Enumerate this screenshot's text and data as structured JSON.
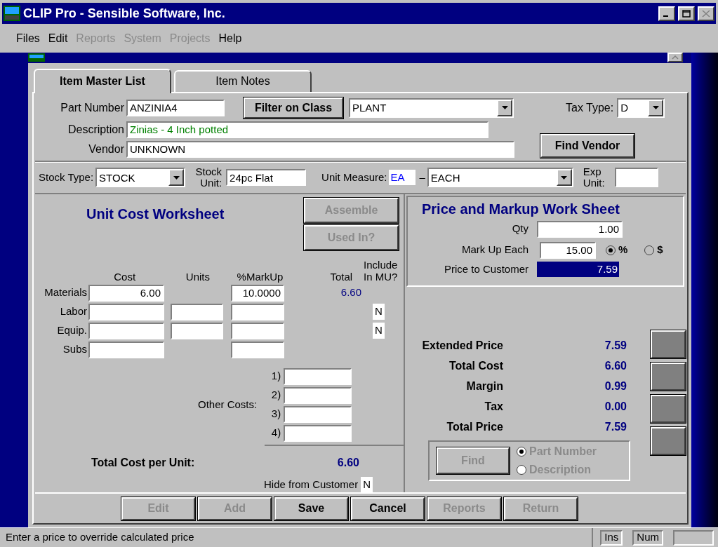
{
  "window": {
    "title": "CLIP Pro - Sensible Software, Inc."
  },
  "menu": [
    {
      "label": "Files",
      "disabled": false
    },
    {
      "label": "Edit",
      "disabled": false
    },
    {
      "label": "Reports",
      "disabled": true
    },
    {
      "label": "System",
      "disabled": true
    },
    {
      "label": "Projects",
      "disabled": true
    },
    {
      "label": "Help",
      "disabled": false
    }
  ],
  "tabs": [
    {
      "label": "Item Master List",
      "selected": true
    },
    {
      "label": "Item Notes",
      "selected": false
    }
  ],
  "part_number": {
    "label": "Part Number",
    "value": "ANZINIA4"
  },
  "filter_button": {
    "label": "Filter on Class"
  },
  "class_select": {
    "value": "PLANT"
  },
  "tax_type": {
    "label": "Tax Type:",
    "value": "D"
  },
  "description": {
    "label": "Description",
    "value": "Zinias - 4 Inch potted"
  },
  "vendor": {
    "label": "Vendor",
    "value": "UNKNOWN"
  },
  "find_vendor_button": {
    "label": "Find Vendor"
  },
  "stock_type": {
    "label": "Stock Type:",
    "value": "STOCK"
  },
  "stock_unit": {
    "label": "Stock Unit:",
    "value": "24pc Flat"
  },
  "unit_measure": {
    "label": "Unit Measure:",
    "code": "EA",
    "separator": "–",
    "value": "EACH"
  },
  "exp_unit": {
    "label": "Exp Unit:"
  },
  "unit_cost_worksheet": {
    "title": "Unit Cost Worksheet",
    "buttons": [
      {
        "label": "Assemble",
        "disabled": true
      },
      {
        "label": "Used In?",
        "disabled": true
      }
    ],
    "columns": [
      "Cost",
      "Units",
      "%MarkUp",
      "Total",
      "Include In MU?"
    ],
    "rows": [
      {
        "label": "Materials",
        "cells": [
          {
            "field": true,
            "value": "6.00"
          },
          {
            "field": false
          },
          {
            "field": true,
            "value": "10.0000"
          }
        ],
        "total": "6.60"
      },
      {
        "label": "Labor",
        "cells": [
          {
            "field": true
          },
          {
            "field": true
          },
          {
            "field": true
          }
        ],
        "include": "N"
      },
      {
        "label": "Equip.",
        "cells": [
          {
            "field": true
          },
          {
            "field": true
          },
          {
            "field": true
          }
        ],
        "include": "N"
      },
      {
        "label": "Subs",
        "cells": [
          {
            "field": true
          },
          {
            "field": false
          },
          {
            "field": true
          }
        ]
      }
    ],
    "other_costs": {
      "label": "Other Costs:",
      "lines": [
        "1)",
        "2)",
        "3)",
        "4)"
      ]
    },
    "total_cost_per_unit": {
      "label": "Total Cost per Unit:",
      "value": "6.60"
    },
    "hide_from_customer": {
      "label": "Hide from Customer",
      "value": "N"
    }
  },
  "price_worksheet": {
    "title": "Price and Markup Work Sheet",
    "qty": {
      "label": "Qty",
      "value": "1.00"
    },
    "markup_each": {
      "label": "Mark Up Each",
      "value": "15.00",
      "modes": [
        {
          "label": "%",
          "selected": true
        },
        {
          "label": "$",
          "selected": false
        }
      ]
    },
    "price_to_customer": {
      "label": "Price to Customer",
      "value": "7.59"
    }
  },
  "summary": [
    {
      "label": "Extended Price",
      "value": "7.59"
    },
    {
      "label": "Total Cost",
      "value": "6.60"
    },
    {
      "label": "Margin",
      "value": "0.99"
    },
    {
      "label": "Tax",
      "value": "0.00"
    },
    {
      "label": "Total Price",
      "value": "7.59"
    }
  ],
  "find": {
    "button": "Find",
    "disabled": true,
    "options": [
      {
        "label": "Part Number",
        "selected": true
      },
      {
        "label": "Description",
        "selected": false
      }
    ]
  },
  "bottom_buttons": [
    {
      "label": "Edit",
      "disabled": true
    },
    {
      "label": "Add",
      "disabled": true
    },
    {
      "label": "Save",
      "disabled": false
    },
    {
      "label": "Cancel",
      "disabled": false
    },
    {
      "label": "Reports",
      "disabled": true
    },
    {
      "label": "Return",
      "disabled": true
    }
  ],
  "status_bar": {
    "message": "Enter a price to override calculated price",
    "indicators": [
      "Ins",
      "Num"
    ]
  }
}
